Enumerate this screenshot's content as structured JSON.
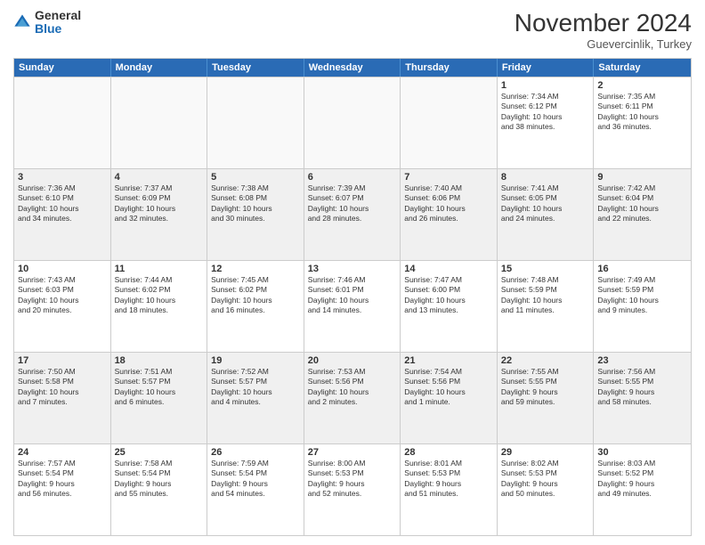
{
  "header": {
    "logo": {
      "general": "General",
      "blue": "Blue"
    },
    "title": "November 2024",
    "location": "Guevercinlik, Turkey"
  },
  "calendar": {
    "weekdays": [
      "Sunday",
      "Monday",
      "Tuesday",
      "Wednesday",
      "Thursday",
      "Friday",
      "Saturday"
    ],
    "weeks": [
      [
        {
          "day": "",
          "info": ""
        },
        {
          "day": "",
          "info": ""
        },
        {
          "day": "",
          "info": ""
        },
        {
          "day": "",
          "info": ""
        },
        {
          "day": "",
          "info": ""
        },
        {
          "day": "1",
          "info": "Sunrise: 7:34 AM\nSunset: 6:12 PM\nDaylight: 10 hours\nand 38 minutes."
        },
        {
          "day": "2",
          "info": "Sunrise: 7:35 AM\nSunset: 6:11 PM\nDaylight: 10 hours\nand 36 minutes."
        }
      ],
      [
        {
          "day": "3",
          "info": "Sunrise: 7:36 AM\nSunset: 6:10 PM\nDaylight: 10 hours\nand 34 minutes."
        },
        {
          "day": "4",
          "info": "Sunrise: 7:37 AM\nSunset: 6:09 PM\nDaylight: 10 hours\nand 32 minutes."
        },
        {
          "day": "5",
          "info": "Sunrise: 7:38 AM\nSunset: 6:08 PM\nDaylight: 10 hours\nand 30 minutes."
        },
        {
          "day": "6",
          "info": "Sunrise: 7:39 AM\nSunset: 6:07 PM\nDaylight: 10 hours\nand 28 minutes."
        },
        {
          "day": "7",
          "info": "Sunrise: 7:40 AM\nSunset: 6:06 PM\nDaylight: 10 hours\nand 26 minutes."
        },
        {
          "day": "8",
          "info": "Sunrise: 7:41 AM\nSunset: 6:05 PM\nDaylight: 10 hours\nand 24 minutes."
        },
        {
          "day": "9",
          "info": "Sunrise: 7:42 AM\nSunset: 6:04 PM\nDaylight: 10 hours\nand 22 minutes."
        }
      ],
      [
        {
          "day": "10",
          "info": "Sunrise: 7:43 AM\nSunset: 6:03 PM\nDaylight: 10 hours\nand 20 minutes."
        },
        {
          "day": "11",
          "info": "Sunrise: 7:44 AM\nSunset: 6:02 PM\nDaylight: 10 hours\nand 18 minutes."
        },
        {
          "day": "12",
          "info": "Sunrise: 7:45 AM\nSunset: 6:02 PM\nDaylight: 10 hours\nand 16 minutes."
        },
        {
          "day": "13",
          "info": "Sunrise: 7:46 AM\nSunset: 6:01 PM\nDaylight: 10 hours\nand 14 minutes."
        },
        {
          "day": "14",
          "info": "Sunrise: 7:47 AM\nSunset: 6:00 PM\nDaylight: 10 hours\nand 13 minutes."
        },
        {
          "day": "15",
          "info": "Sunrise: 7:48 AM\nSunset: 5:59 PM\nDaylight: 10 hours\nand 11 minutes."
        },
        {
          "day": "16",
          "info": "Sunrise: 7:49 AM\nSunset: 5:59 PM\nDaylight: 10 hours\nand 9 minutes."
        }
      ],
      [
        {
          "day": "17",
          "info": "Sunrise: 7:50 AM\nSunset: 5:58 PM\nDaylight: 10 hours\nand 7 minutes."
        },
        {
          "day": "18",
          "info": "Sunrise: 7:51 AM\nSunset: 5:57 PM\nDaylight: 10 hours\nand 6 minutes."
        },
        {
          "day": "19",
          "info": "Sunrise: 7:52 AM\nSunset: 5:57 PM\nDaylight: 10 hours\nand 4 minutes."
        },
        {
          "day": "20",
          "info": "Sunrise: 7:53 AM\nSunset: 5:56 PM\nDaylight: 10 hours\nand 2 minutes."
        },
        {
          "day": "21",
          "info": "Sunrise: 7:54 AM\nSunset: 5:56 PM\nDaylight: 10 hours\nand 1 minute."
        },
        {
          "day": "22",
          "info": "Sunrise: 7:55 AM\nSunset: 5:55 PM\nDaylight: 9 hours\nand 59 minutes."
        },
        {
          "day": "23",
          "info": "Sunrise: 7:56 AM\nSunset: 5:55 PM\nDaylight: 9 hours\nand 58 minutes."
        }
      ],
      [
        {
          "day": "24",
          "info": "Sunrise: 7:57 AM\nSunset: 5:54 PM\nDaylight: 9 hours\nand 56 minutes."
        },
        {
          "day": "25",
          "info": "Sunrise: 7:58 AM\nSunset: 5:54 PM\nDaylight: 9 hours\nand 55 minutes."
        },
        {
          "day": "26",
          "info": "Sunrise: 7:59 AM\nSunset: 5:54 PM\nDaylight: 9 hours\nand 54 minutes."
        },
        {
          "day": "27",
          "info": "Sunrise: 8:00 AM\nSunset: 5:53 PM\nDaylight: 9 hours\nand 52 minutes."
        },
        {
          "day": "28",
          "info": "Sunrise: 8:01 AM\nSunset: 5:53 PM\nDaylight: 9 hours\nand 51 minutes."
        },
        {
          "day": "29",
          "info": "Sunrise: 8:02 AM\nSunset: 5:53 PM\nDaylight: 9 hours\nand 50 minutes."
        },
        {
          "day": "30",
          "info": "Sunrise: 8:03 AM\nSunset: 5:52 PM\nDaylight: 9 hours\nand 49 minutes."
        }
      ]
    ]
  }
}
